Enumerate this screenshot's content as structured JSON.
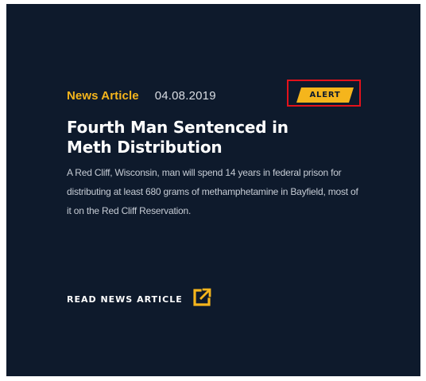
{
  "article": {
    "category": "News Article",
    "date": "04.08.2019",
    "badge": "ALERT",
    "title": "Fourth Man Sentenced in Meth Distribution",
    "summary": "A Red Cliff, Wisconsin, man will spend 14 years in federal prison for distributing at least 680 grams of methamphetamine in Bayfield, most of it on the Red Cliff Reservation.",
    "link_label": "READ NEWS ARTICLE",
    "link_icon": "external-link-icon"
  },
  "colors": {
    "background": "#0e1a2c",
    "accent": "#f5b51c",
    "highlight_frame": "#e3121b",
    "title": "#ffffff",
    "body_text": "#c6ccd5"
  }
}
